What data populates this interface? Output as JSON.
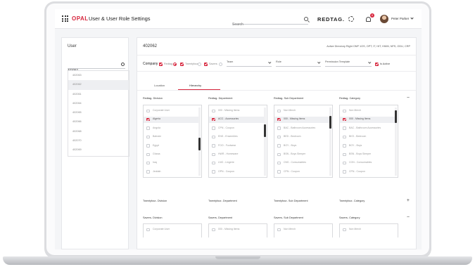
{
  "topbar": {
    "brand": "OPAL",
    "title": "User & User Role Settings",
    "search_placeholder": "Search",
    "store_logo": "REDTAG.",
    "notification_count": "8",
    "user_name": "Peter Parker"
  },
  "left_panel": {
    "title": "User",
    "search_value": "402062",
    "users": [
      "402063",
      "402062",
      "402061",
      "402064",
      "402065",
      "402066",
      "402068",
      "402070",
      "402069"
    ],
    "selected_index": 1
  },
  "right_panel": {
    "user_id": "402062",
    "info": "Active Directory Right ONP 1OS, OPT, IT, HIT, HWM, NFS, ODU, CRP",
    "company_label": "Company",
    "companies": [
      {
        "label": "Redtag",
        "checked": true,
        "radio": true
      },
      {
        "label": "Twentyfour",
        "checked": true,
        "radio": false
      },
      {
        "label": "Savers",
        "checked": true,
        "radio": false
      }
    ],
    "dropdowns": [
      "Team",
      "Role",
      "Permission Template"
    ],
    "inactive_label": "Is Active",
    "tabs": [
      {
        "label": "Location",
        "active": false
      },
      {
        "label": "Hierarchy",
        "active": true
      }
    ]
  },
  "sections": [
    {
      "name": "Redtag",
      "expanded": true,
      "toggle": "−",
      "columns": [
        {
          "title": "Redtag- Division",
          "thumb": 0.55,
          "items": [
            {
              "label": "Corporate User",
              "checked": false
            },
            {
              "label": "Algeria",
              "checked": true,
              "hl": true
            },
            {
              "label": "Angola",
              "checked": false
            },
            {
              "label": "Bahrain",
              "checked": false
            },
            {
              "label": "Egypt",
              "checked": false
            },
            {
              "label": "Ghana",
              "checked": false
            },
            {
              "label": "Iraq",
              "checked": false
            },
            {
              "label": "Jeddah",
              "checked": false
            }
          ]
        },
        {
          "title": "Redtag- Department",
          "thumb": 0.3,
          "items": [
            {
              "label": "000 - Missing Items",
              "checked": false
            },
            {
              "label": "ACC - Accessories",
              "checked": true,
              "hl": true
            },
            {
              "label": "CPN - Coupon",
              "checked": false
            },
            {
              "label": "ENS - Ensembles",
              "checked": false
            },
            {
              "label": "FOO - Footwear",
              "checked": false
            },
            {
              "label": "HWR - Homeware",
              "checked": false
            },
            {
              "label": "LNG - Lingerie",
              "checked": false
            },
            {
              "label": "OPN - Coupon",
              "checked": false
            }
          ]
        },
        {
          "title": "Redtag- Sub Department",
          "thumb": 0.15,
          "items": [
            {
              "label": "Non Merch",
              "checked": false
            },
            {
              "label": "000 - Missing Items",
              "checked": true,
              "hl": true
            },
            {
              "label": "BAC - Bathroom Accessories",
              "checked": false
            },
            {
              "label": "BED - Bedroom",
              "checked": false
            },
            {
              "label": "BOY - Boys",
              "checked": false
            },
            {
              "label": "BSN - Boys Sleeper",
              "checked": false
            },
            {
              "label": "CNS - Consumables",
              "checked": false
            },
            {
              "label": "CPN - Coupon",
              "checked": false
            }
          ]
        },
        {
          "title": "Redtag- Category",
          "thumb": 0.05,
          "items": [
            {
              "label": "Non Merch",
              "checked": false
            },
            {
              "label": "000 - Missing Items",
              "checked": true,
              "hl": true
            },
            {
              "label": "BAC - Bathroom Accessories",
              "checked": false
            },
            {
              "label": "BKS - Bedroom",
              "checked": false
            },
            {
              "label": "BOY - Boys",
              "checked": false
            },
            {
              "label": "BSN - Boys Sleeper",
              "checked": false
            },
            {
              "label": "CON - Consumables",
              "checked": false
            },
            {
              "label": "CPN - Coupon",
              "checked": false
            }
          ]
        }
      ]
    },
    {
      "name": "Twentyfour",
      "expanded": false,
      "toggle": "+",
      "columns": [
        {
          "title": "Twentyfour- Division"
        },
        {
          "title": "Twentyfour- Department"
        },
        {
          "title": "Twentyfour- Sub Department"
        },
        {
          "title": "Twentyfour- Category"
        }
      ]
    },
    {
      "name": "Savers",
      "expanded": true,
      "toggle": "−",
      "columns": [
        {
          "title": "Savers- Division",
          "items": [
            {
              "label": "Corporate User",
              "checked": false
            }
          ]
        },
        {
          "title": "Savers- Department",
          "items": [
            {
              "label": "000 - Missing Items",
              "checked": false
            }
          ]
        },
        {
          "title": "Savers- Sub Department",
          "items": [
            {
              "label": "Non Merch",
              "checked": false
            }
          ]
        },
        {
          "title": "Savers- Category",
          "items": [
            {
              "label": "Non Merch",
              "checked": false
            }
          ]
        }
      ]
    }
  ],
  "colors": {
    "accent": "#d7263d",
    "background": "#f4f5f7"
  }
}
